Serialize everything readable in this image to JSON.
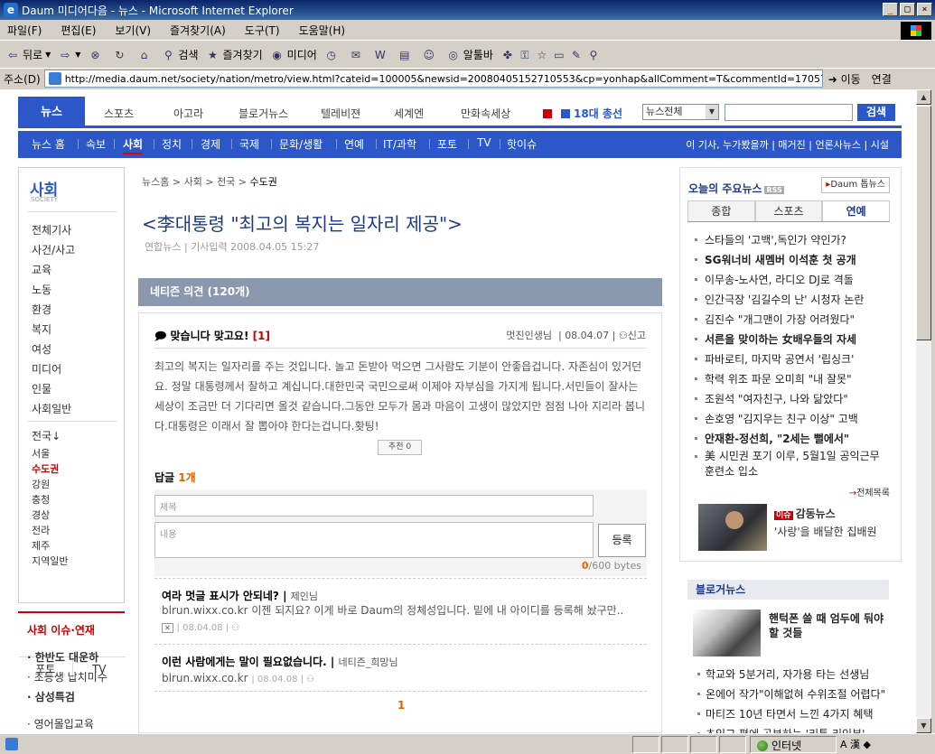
{
  "window": {
    "title": "Daum 미디어다음 - 뉴스 - Microsoft Internet Explorer",
    "min": "_",
    "max": "□",
    "close": "×"
  },
  "menu": [
    "파일(F)",
    "편집(E)",
    "보기(V)",
    "즐겨찾기(A)",
    "도구(T)",
    "도움말(H)"
  ],
  "toolbar": {
    "back": "뒤로",
    "search": "검색",
    "favorites": "즐겨찾기",
    "media": "미디어",
    "altoolbar": "알툴바"
  },
  "address": {
    "label": "주소(D)",
    "url": "http://media.daum.net/society/nation/metro/view.html?cateid=100005&newsid=20080405152710553&cp=yonhap&allComment=T&commentId=170577",
    "go": "이동",
    "links": "연결"
  },
  "nav1": {
    "items": [
      "뉴스",
      "스포츠",
      "아고라",
      "블로거뉴스",
      "텔레비젼",
      "세계엔",
      "만화속세상",
      "18대 총선"
    ],
    "search_select": "뉴스전체",
    "search_btn": "검색"
  },
  "nav2": {
    "items": [
      "뉴스 홈",
      "속보",
      "사회",
      "정치",
      "경제",
      "국제",
      "문화/생활",
      "연예",
      "IT/과학",
      "포토",
      "TV",
      "핫이슈"
    ],
    "right": "이 기사, 누가봤을까 | 매거진 | 언론사뉴스 | 시설"
  },
  "left": {
    "title": "사회",
    "sub": "SOCIETY",
    "menu": [
      "전체기사",
      "사건/사고",
      "교육",
      "노동",
      "환경",
      "복지",
      "여성",
      "미디어",
      "인물",
      "사회일반"
    ],
    "region_head": "전국↓",
    "regions": [
      "서울",
      "수도권",
      "강원",
      "충청",
      "경상",
      "전라",
      "제주",
      "지역일반"
    ],
    "bottom": [
      "포토",
      "TV"
    ],
    "issue_title": "사회 이슈·연재",
    "issues": [
      "한반도 대운하",
      "초등생 납치미수",
      "삼성특검",
      "영어몰입교육"
    ]
  },
  "article": {
    "breadcrumb": [
      "뉴스홈",
      "사회",
      "전국",
      "수도권"
    ],
    "headline": "<李대통령 \"최고의 복지는 일자리 제공\">",
    "source": "연합뉴스",
    "date": "기사입력 2008.04.05 15:27"
  },
  "comments": {
    "header": "네티즌 의견 (120개)",
    "title": "맞습니다 맞고요!",
    "title_count": "[1]",
    "author": "멋진인생님",
    "date": "08.04.07",
    "report": "신고",
    "body": "최고의 복지는 일자리를 주는 것입니다. 놀고 돈받아 먹으면 그사람도 기분이 안좋읍겁니다. 자존심이 있거던요. 정말 대통령께서 잘하고 계십니다.대한민국 국민으로써 이제야 자부심을 가지게 됩니다.서민들이 잘사는 세상이 조금만 더 기다리면 올것 같습니다.그동안 모두가 몸과 마음이 고생이 많았지만 점점 나아 지리라 봅니다.대통령은 이래서 잘 뽑아야 한다는겁니다.홧팅!",
    "recommend": "추천 0",
    "reply_label": "답글",
    "reply_count": "1개",
    "subject_ph": "제목",
    "content_ph": "내용",
    "register": "등록",
    "bytes_now": "0",
    "bytes_max": "/600 bytes",
    "replies": [
      {
        "title": "여라 멋글 표시가 안되네?",
        "author": "제인님",
        "body": "blrun.wixx.co.kr 이젠 되지요? 이게 바로 Daum의 정체성입니다. 밑에 내 아이디를 등록해 놨구만..",
        "date": "08.04.08"
      },
      {
        "title": "이런 사람에게는 말이 필요없습니다.",
        "author": "네티즌_희망님",
        "body": "blrun.wixx.co.kr",
        "date": "08.04.08"
      }
    ],
    "page": "1"
  },
  "right": {
    "title": "오늘의 주요뉴스",
    "rss": "RSS",
    "top_btn": "Daum 톱뉴스",
    "tabs": [
      "종합",
      "스포츠",
      "연예"
    ],
    "news": [
      "스타들의 '고백',독인가 약인가?",
      "SG워너비 새멤버 이석훈 첫 공개",
      "이무송-노사연, 라디오 DJ로 격돌",
      "인간극장 '김길수의 난' 시청자 논란",
      "김진수 \"개그맨이 가장 어려웠다\"",
      "서른을 맞이하는 女배우들의 자세",
      "파바로티, 마지막 공연서 '립싱크'",
      "학력 위조 파문 오미희 \"내 잘못\"",
      "조원석 \"여자친구, 나와 닮았다\"",
      "손호영 \"김지우는 친구 이상\" 고백",
      "안재환-정선희, \"2세는 뻘에서\"",
      "美 시민권 포기 이루, 5월1일 공익근무 훈련소 입소"
    ],
    "more": "전체목록",
    "good_badge": "이슈",
    "good_title": "감동뉴스",
    "good_sub": "'사랑'을 배달한 집배원",
    "blog_title": "블로거뉴스",
    "blog_main": "핸턱폰 쓸 때 엄두에 둬야 할 것들",
    "blog_list": [
      "학교와 5분거리, 자가용 타는 선생님",
      "온에어 작가\"이해없혀 수위조절 어렵다\"",
      "마티즈 10년 타면서 느낀 4가지 혜택",
      "초임교 편에 공부하는 '리툼 리인분'"
    ]
  },
  "status": {
    "zone": "인터넷",
    "ime": "A 漢 ◆"
  }
}
